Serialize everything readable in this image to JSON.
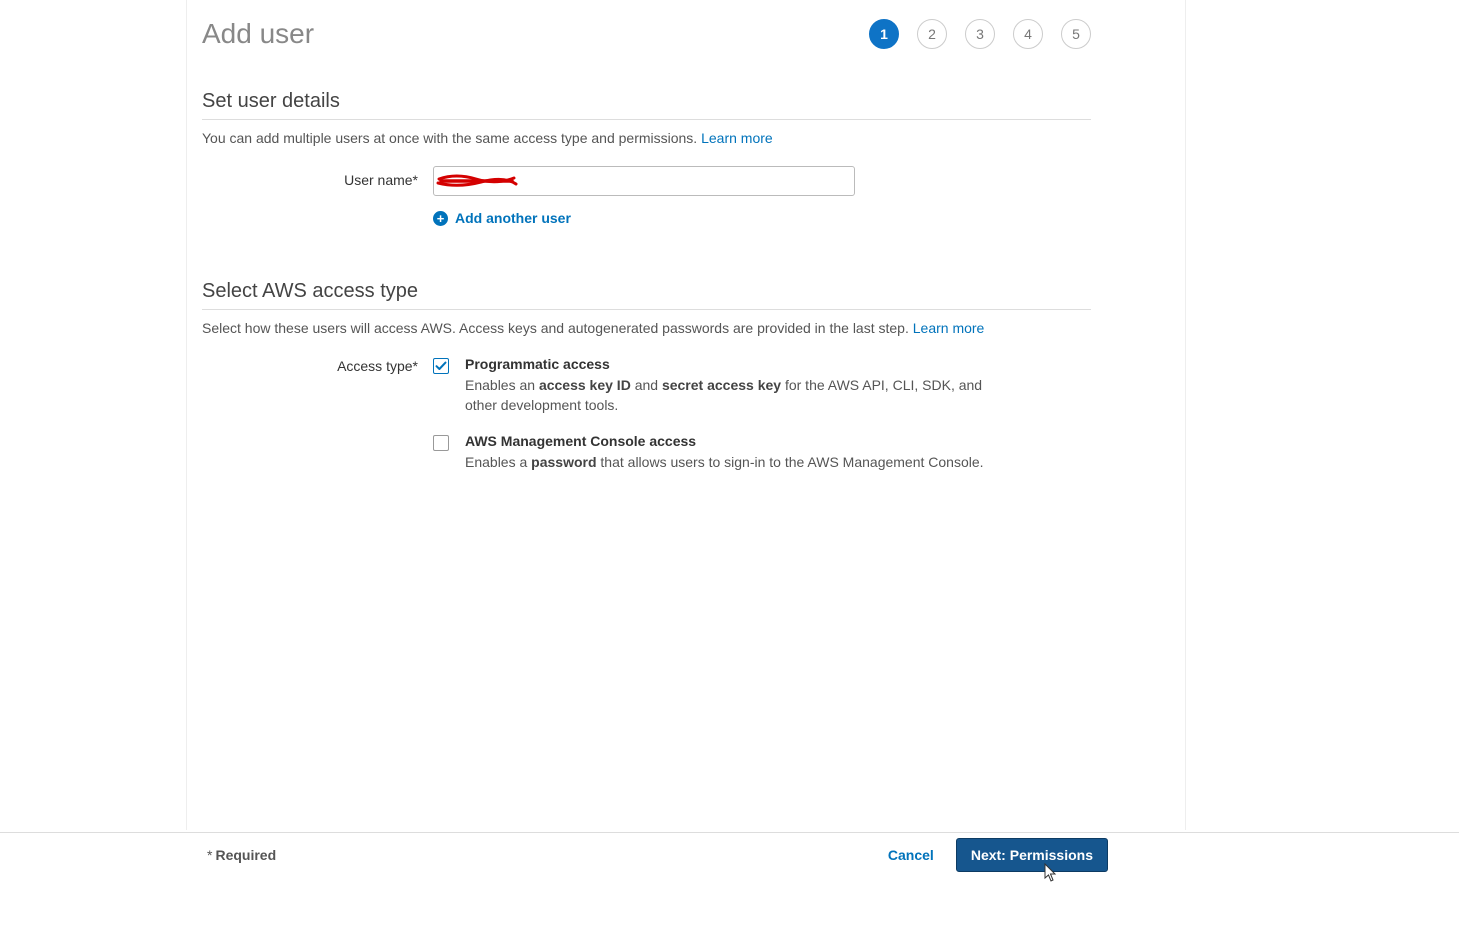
{
  "page": {
    "title": "Add user"
  },
  "steps": {
    "count": 5,
    "active": 1,
    "labels": [
      "1",
      "2",
      "3",
      "4",
      "5"
    ]
  },
  "user_details": {
    "heading": "Set user details",
    "description": "You can add multiple users at once with the same access type and permissions.",
    "learn_more": "Learn more",
    "username_label": "User name*",
    "username_value": "",
    "add_another_label": "Add another user"
  },
  "access_type": {
    "heading": "Select AWS access type",
    "description": "Select how these users will access AWS. Access keys and autogenerated passwords are provided in the last step.",
    "learn_more": "Learn more",
    "label": "Access type*",
    "options": {
      "programmatic": {
        "checked": true,
        "title": "Programmatic access",
        "desc_pre": "Enables an ",
        "desc_b1": "access key ID",
        "desc_mid": " and ",
        "desc_b2": "secret access key",
        "desc_post": " for the AWS API, CLI, SDK, and other development tools."
      },
      "console": {
        "checked": false,
        "title": "AWS Management Console access",
        "desc_pre": "Enables a ",
        "desc_b1": "password",
        "desc_post": " that allows users to sign-in to the AWS Management Console."
      }
    }
  },
  "footer": {
    "required": "Required",
    "cancel": "Cancel",
    "next": "Next: Permissions"
  }
}
